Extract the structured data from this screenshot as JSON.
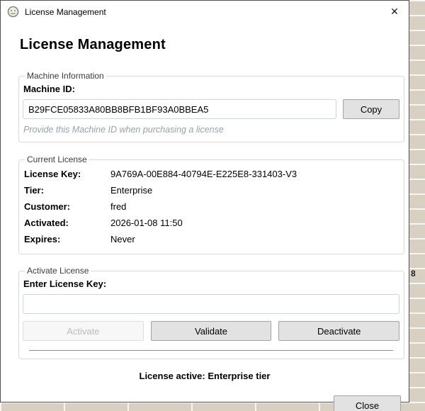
{
  "window": {
    "title": "License Management",
    "close_glyph": "✕"
  },
  "heading": "License Management",
  "machine_info": {
    "legend": "Machine Information",
    "label": "Machine ID:",
    "machine_id": "B29FCE05833A80BB8BFB1BF93A0BBEA5",
    "copy_label": "Copy",
    "caption": "Provide this Machine ID when purchasing a license"
  },
  "current_license": {
    "legend": "Current License",
    "rows": [
      {
        "label": "License Key:",
        "value": "9A769A-00E884-40794E-E225E8-331403-V3"
      },
      {
        "label": "Tier:",
        "value": "Enterprise"
      },
      {
        "label": "Customer:",
        "value": "fred"
      },
      {
        "label": "Activated:",
        "value": "2026-01-08 11:50"
      },
      {
        "label": "Expires:",
        "value": "Never"
      }
    ]
  },
  "activate_section": {
    "legend": "Activate License",
    "label": "Enter License Key:",
    "input_value": "",
    "activate_label": "Activate",
    "validate_label": "Validate",
    "deactivate_label": "Deactivate"
  },
  "status_text": "License active: Enterprise tier",
  "close_button_label": "Close",
  "background": {
    "partial_cell_text": "8"
  },
  "colors": {
    "button_bg": "#e2e2e2",
    "button_border": "#a3a3a3",
    "disabled_text": "#bcbcbc",
    "caption_text": "#9aa1a9",
    "desktop_grid_bg": "#d8d1c3",
    "window_bg": "#ffffff"
  }
}
